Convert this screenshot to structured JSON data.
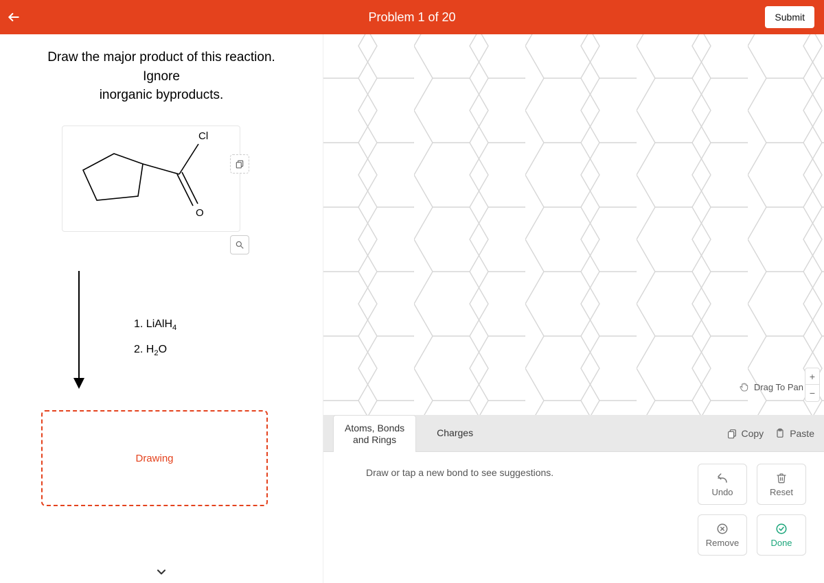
{
  "header": {
    "title": "Problem 1 of 20",
    "submit_label": "Submit"
  },
  "prompt": {
    "line1": "Draw the major product of this reaction. Ignore",
    "line2": "inorganic byproducts."
  },
  "molecule": {
    "label_cl": "Cl",
    "label_o": "O"
  },
  "reagents": {
    "line1": "1. LiAlH",
    "sub1": "4",
    "line2": "2. H",
    "sub2": "2",
    "line2_tail": "O"
  },
  "drawing_box_label": "Drawing",
  "canvas": {
    "drag_label": "Drag To Pan",
    "zoom_plus": "+",
    "zoom_minus": "−"
  },
  "tabs": {
    "atoms_bonds_l1": "Atoms, Bonds",
    "atoms_bonds_l2": "and Rings",
    "charges": "Charges",
    "copy": "Copy",
    "paste": "Paste"
  },
  "hint": "Draw or tap a new bond to see suggestions.",
  "actions": {
    "undo": "Undo",
    "reset": "Reset",
    "remove": "Remove",
    "done": "Done"
  }
}
